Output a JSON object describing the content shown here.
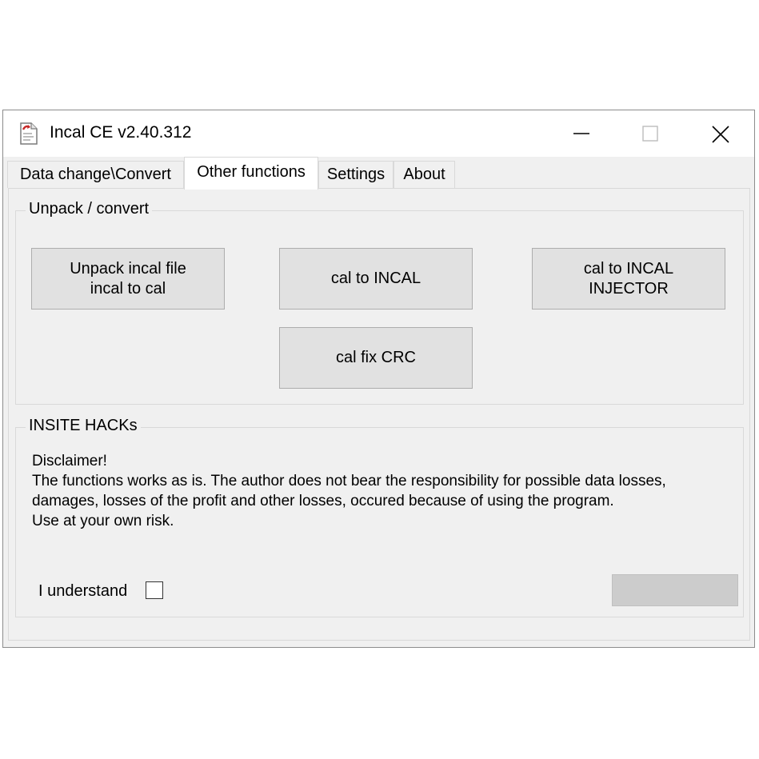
{
  "window": {
    "title": "Incal CE v2.40.312",
    "icon": "document-icon",
    "controls": {
      "minimize": "minimize-icon",
      "maximize": "maximize-icon",
      "close": "close-icon"
    }
  },
  "tabs": [
    {
      "label": "Data change\\Convert"
    },
    {
      "label": "Other functions"
    },
    {
      "label": "Settings"
    },
    {
      "label": "About"
    }
  ],
  "unpack_group": {
    "legend": "Unpack / convert",
    "buttons": [
      {
        "lines": [
          "Unpack incal file",
          "incal to cal"
        ]
      },
      {
        "lines": [
          "cal to INCAL"
        ]
      },
      {
        "lines": [
          "cal to INCAL",
          "INJECTOR"
        ]
      },
      {
        "lines": [
          "cal fix CRC"
        ]
      }
    ]
  },
  "insite_group": {
    "legend": "INSITE HACKs",
    "disclaimer": [
      "Disclaimer!",
      "The functions works as is. The author does not bear the responsibility for possible data losses,",
      "damages, losses of the profit and other losses, occured because of using the program.",
      "Use at your own risk."
    ],
    "checkbox_label": "I understand",
    "checkbox_checked": false,
    "action_button_label": ""
  }
}
